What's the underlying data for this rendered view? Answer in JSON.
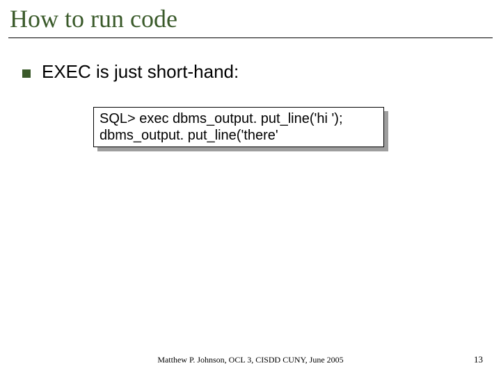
{
  "title": "How to run code",
  "bullet": "EXEC is just short-hand:",
  "code": {
    "line1": "SQL> exec dbms_output. put_line('hi ');",
    "line2": "dbms_output. put_line('there'"
  },
  "footer": "Matthew P. Johnson, OCL 3, CISDD CUNY, June 2005",
  "pagenum": "13"
}
